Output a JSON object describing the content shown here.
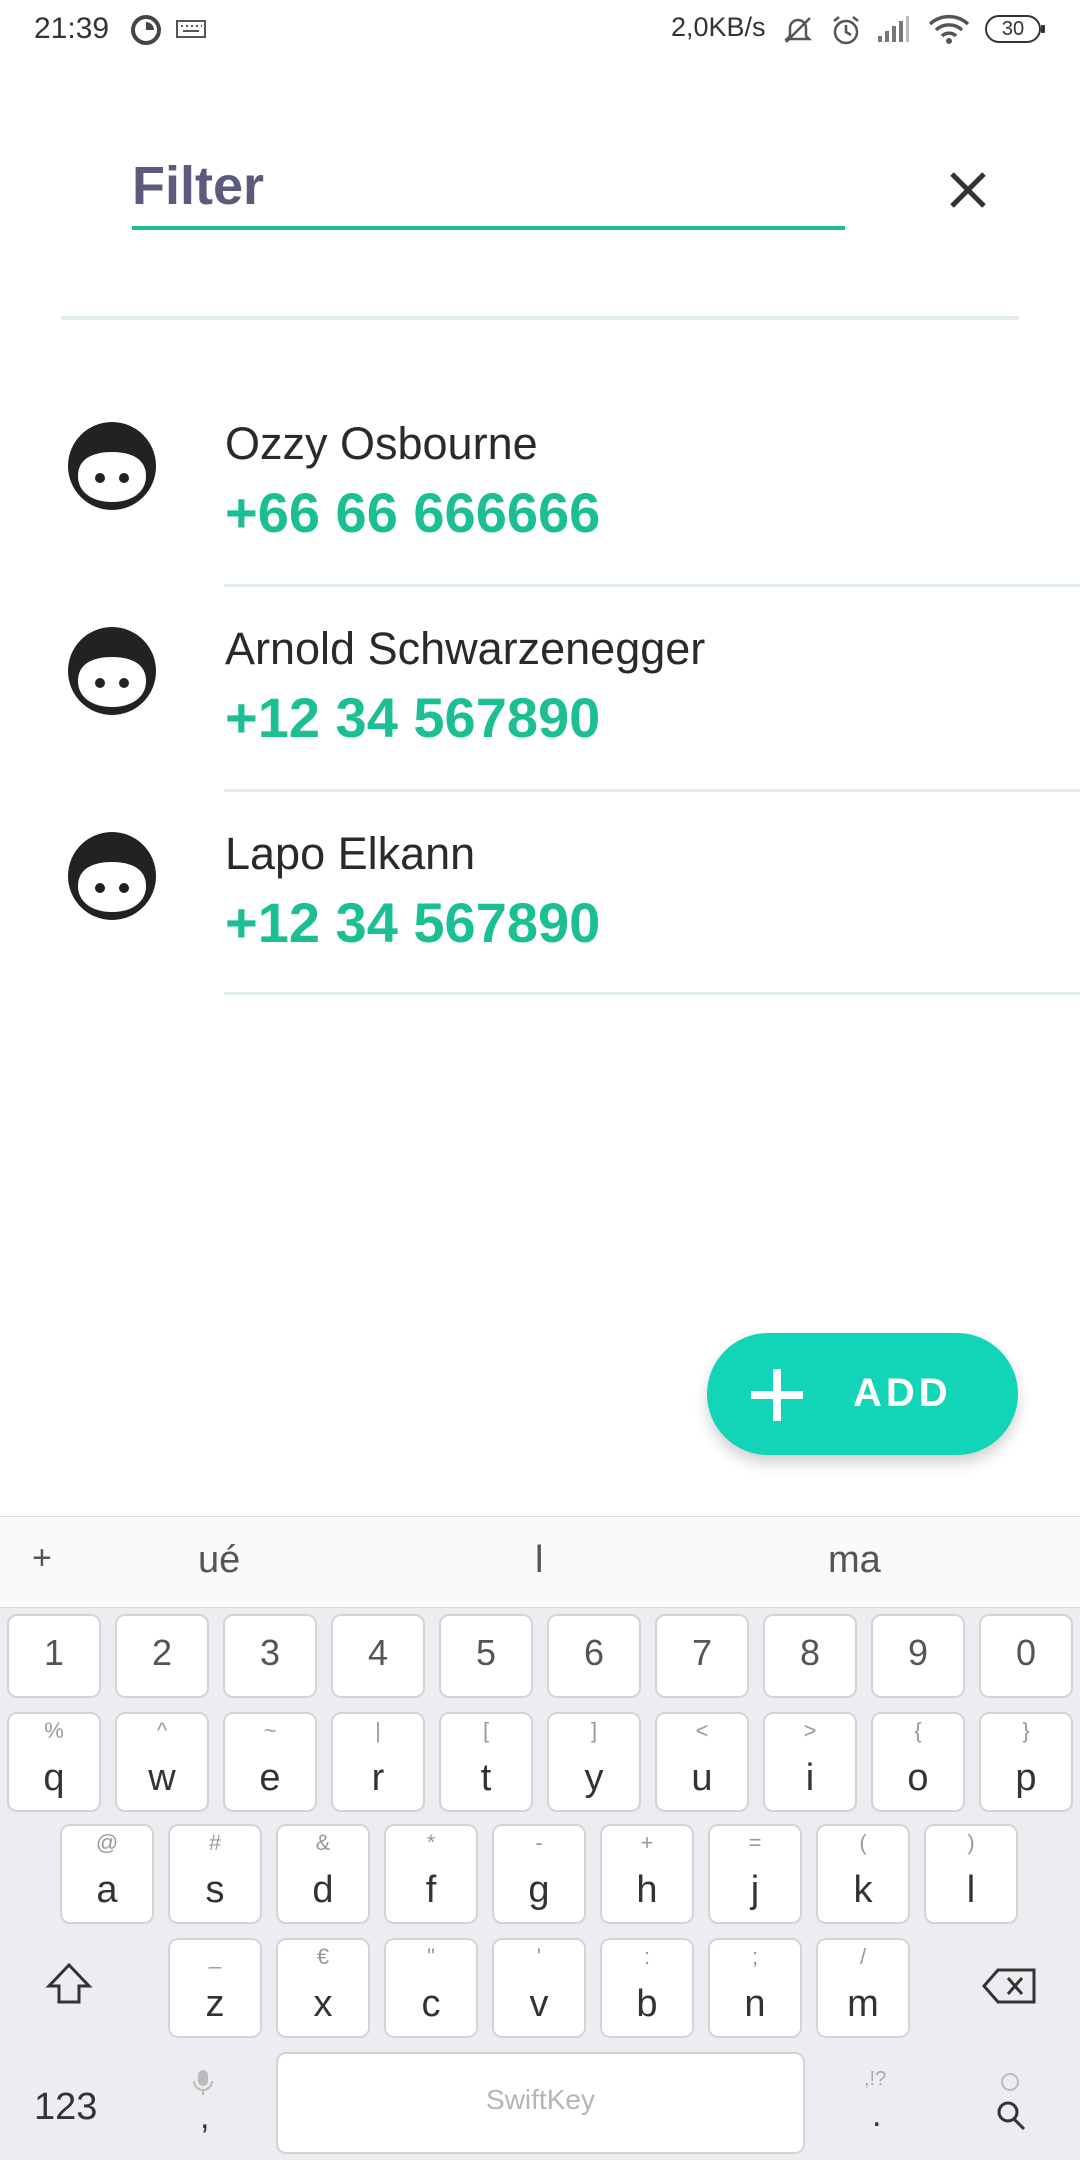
{
  "status_bar": {
    "time": "21:39",
    "network_speed": "2,0KB/s",
    "battery": "30"
  },
  "filter": {
    "placeholder": "Filter",
    "value": ""
  },
  "contacts": [
    {
      "name": "Ozzy Osbourne",
      "phone": "+66 66 666666"
    },
    {
      "name": "Arnold Schwarzenegger",
      "phone": "+12 34 567890"
    },
    {
      "name": "Lapo Elkann",
      "phone": "+12 34 567890"
    }
  ],
  "add_button": {
    "label": "ADD"
  },
  "keyboard": {
    "suggestions": [
      "+",
      "ué",
      "l",
      "ma"
    ],
    "number_row": [
      "1",
      "2",
      "3",
      "4",
      "5",
      "6",
      "7",
      "8",
      "9",
      "0"
    ],
    "row1": [
      {
        "key": "q",
        "alt": "%"
      },
      {
        "key": "w",
        "alt": "^"
      },
      {
        "key": "e",
        "alt": "~"
      },
      {
        "key": "r",
        "alt": "|"
      },
      {
        "key": "t",
        "alt": "["
      },
      {
        "key": "y",
        "alt": "]"
      },
      {
        "key": "u",
        "alt": "<"
      },
      {
        "key": "i",
        "alt": ">"
      },
      {
        "key": "o",
        "alt": "{"
      },
      {
        "key": "p",
        "alt": "}"
      }
    ],
    "row2": [
      {
        "key": "a",
        "alt": "@"
      },
      {
        "key": "s",
        "alt": "#"
      },
      {
        "key": "d",
        "alt": "&"
      },
      {
        "key": "f",
        "alt": "*"
      },
      {
        "key": "g",
        "alt": "-"
      },
      {
        "key": "h",
        "alt": "+"
      },
      {
        "key": "j",
        "alt": "="
      },
      {
        "key": "k",
        "alt": "("
      },
      {
        "key": "l",
        "alt": ")"
      }
    ],
    "row3": [
      {
        "key": "z",
        "alt": "_"
      },
      {
        "key": "x",
        "alt": "€"
      },
      {
        "key": "c",
        "alt": "\""
      },
      {
        "key": "v",
        "alt": "'"
      },
      {
        "key": "b",
        "alt": ":"
      },
      {
        "key": "n",
        "alt": ";"
      },
      {
        "key": "m",
        "alt": "/"
      }
    ],
    "bottom": {
      "symbols_label": "123",
      "comma": ",",
      "space_brand": "SwiftKey",
      "period": ".",
      "period_alt": ",!?"
    }
  },
  "colors": {
    "accent_green": "#1cbf94",
    "add_button": "#12d4b7",
    "filter_text": "#5c5b7d"
  }
}
